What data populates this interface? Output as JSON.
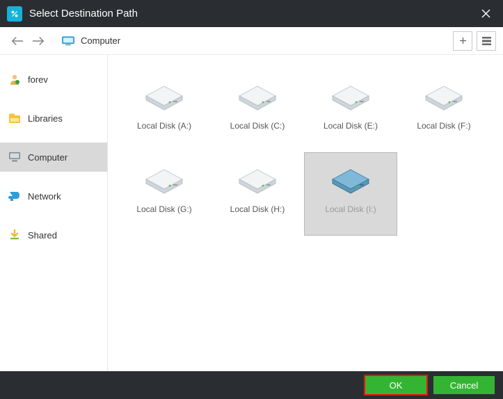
{
  "window": {
    "title": "Select Destination Path"
  },
  "breadcrumb": {
    "label": "Computer"
  },
  "sidebar": {
    "items": [
      {
        "label": "forev"
      },
      {
        "label": "Libraries"
      },
      {
        "label": "Computer"
      },
      {
        "label": "Network"
      },
      {
        "label": "Shared"
      }
    ]
  },
  "disks": [
    {
      "label": "Local Disk (A:)"
    },
    {
      "label": "Local Disk (C:)"
    },
    {
      "label": "Local Disk (E:)"
    },
    {
      "label": "Local Disk (F:)"
    },
    {
      "label": "Local Disk (G:)"
    },
    {
      "label": "Local Disk (H:)"
    },
    {
      "label": "Local Disk (I:)"
    }
  ],
  "footer": {
    "ok": "OK",
    "cancel": "Cancel"
  }
}
